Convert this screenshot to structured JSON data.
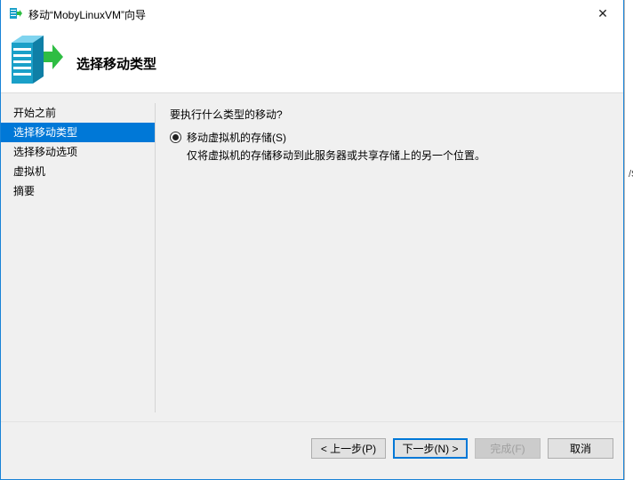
{
  "window": {
    "title": "移动“MobyLinuxVM”向导",
    "close_symbol": "✕"
  },
  "header": {
    "title": "选择移动类型"
  },
  "nav": {
    "items": [
      {
        "label": "开始之前",
        "selected": false
      },
      {
        "label": "选择移动类型",
        "selected": true
      },
      {
        "label": "选择移动选项",
        "selected": false
      },
      {
        "label": "虚拟机",
        "selected": false
      },
      {
        "label": "摘要",
        "selected": false
      }
    ]
  },
  "content": {
    "question": "要执行什么类型的移动?",
    "option": {
      "label": "移动虚拟机的存储(S)",
      "checked": true,
      "description": "仅将虚拟机的存储移动到此服务器或共享存储上的另一个位置。"
    }
  },
  "buttons": {
    "prev": "< 上一步(P)",
    "next": "下一步(N) >",
    "finish": "完成(F)",
    "cancel": "取消"
  },
  "background_window": {
    "fragment": "/S"
  },
  "colors": {
    "selection": "#0078d7",
    "window_border": "#1883d7",
    "arrow_green": "#2ebd43",
    "server_teal": "#1aa0c8"
  },
  "icons": {
    "app": "wizard-server-icon",
    "hero": "server-move-icon",
    "close": "close-icon"
  }
}
